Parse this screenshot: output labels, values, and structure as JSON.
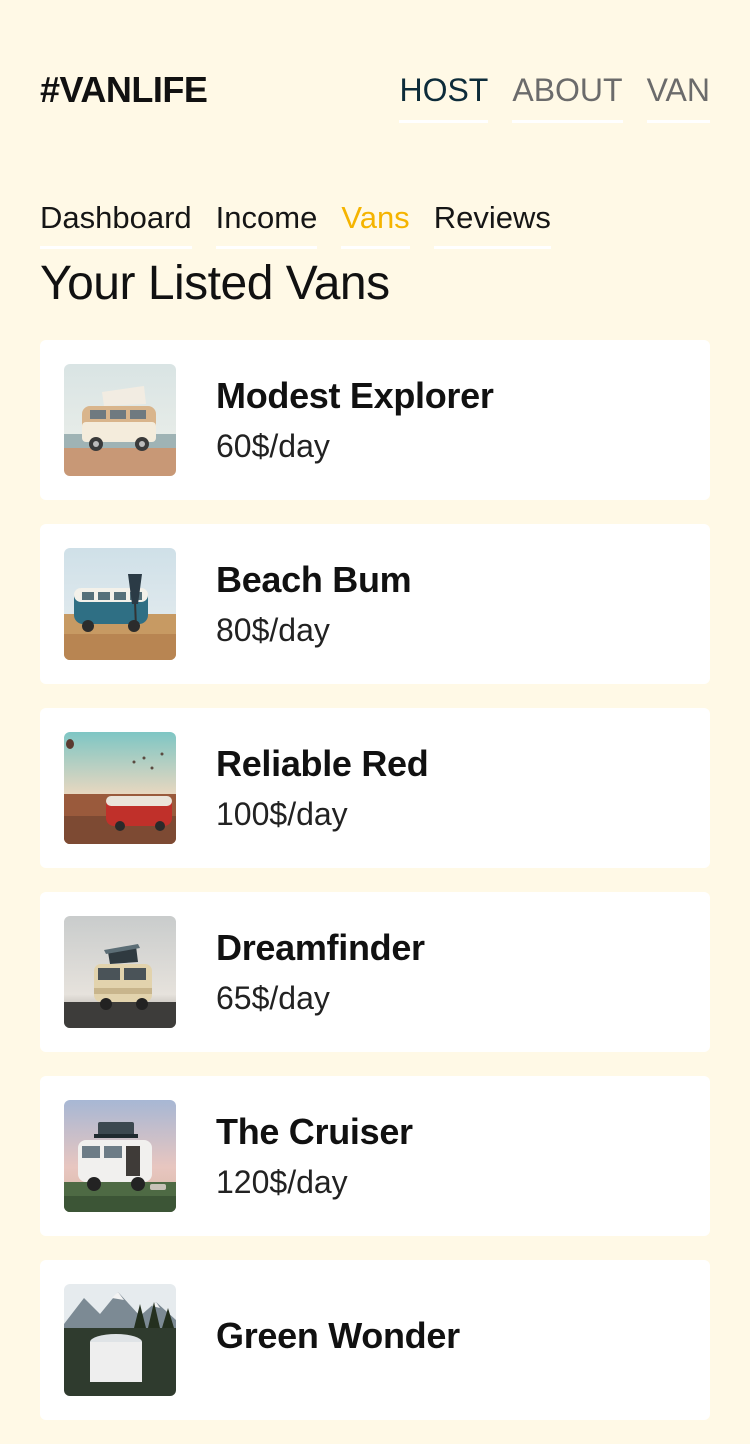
{
  "header": {
    "logo": "#VANLIFE",
    "nav": [
      {
        "label": "HOST"
      },
      {
        "label": "ABOUT"
      },
      {
        "label": "VAN"
      }
    ]
  },
  "host_nav": {
    "items": [
      {
        "label": "Dashboard"
      },
      {
        "label": "Income"
      },
      {
        "label": "Vans"
      },
      {
        "label": "Reviews"
      }
    ],
    "active": "Vans"
  },
  "page": {
    "title": "Your Listed Vans"
  },
  "vans": [
    {
      "name": "Modest Explorer",
      "price": "60$/day",
      "image": "beige van with pop-top by the sea"
    },
    {
      "name": "Beach Bum",
      "price": "80$/day",
      "image": "blue and white van on a beach"
    },
    {
      "name": "Reliable Red",
      "price": "100$/day",
      "image": "red van under hot air balloons"
    },
    {
      "name": "Dreamfinder",
      "price": "65$/day",
      "image": "cream van with surfboard at dusk"
    },
    {
      "name": "The Cruiser",
      "price": "120$/day",
      "image": "white van with roof tent"
    },
    {
      "name": "Green Wonder",
      "price": "",
      "image": "van in front of mountains"
    }
  ],
  "colors": {
    "background": "#FFF9E6",
    "active_nav": "#0D2C3A",
    "inactive_nav": "#6B6B6B",
    "active_tab": "#F5B400",
    "card": "#FFFFFF"
  }
}
